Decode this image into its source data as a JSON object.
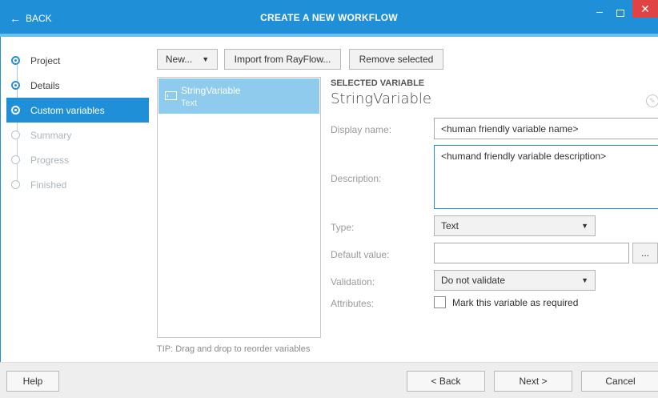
{
  "window": {
    "back_label": "BACK",
    "title": "CREATE A NEW WORKFLOW",
    "minimize_glyph": "–",
    "close_glyph": "✕",
    "accent_color": "#1f90d7"
  },
  "sidebar": {
    "steps": [
      {
        "label": "Project",
        "state": "done"
      },
      {
        "label": "Details",
        "state": "done"
      },
      {
        "label": "Custom variables",
        "state": "active"
      },
      {
        "label": "Summary",
        "state": "pending"
      },
      {
        "label": "Progress",
        "state": "pending"
      },
      {
        "label": "Finished",
        "state": "pending"
      }
    ]
  },
  "toolbar": {
    "new_label": "New...",
    "import_label": "Import from RayFlow...",
    "remove_label": "Remove selected"
  },
  "variables": {
    "items": [
      {
        "name": "StringVariable",
        "type": "Text",
        "icon": "text-variable-icon"
      }
    ],
    "tip": "TIP: Drag and drop to reorder variables"
  },
  "details": {
    "heading": "SELECTED VARIABLE",
    "variable_name": "StringVariable",
    "display_name_label": "Display name:",
    "display_name_value": "<human friendly variable name>",
    "description_label": "Description:",
    "description_value": "<humand friendly variable description>",
    "type_label": "Type:",
    "type_value": "Text",
    "default_value_label": "Default value:",
    "default_value": "",
    "browse_label": "...",
    "validation_label": "Validation:",
    "validation_value": "Do not validate",
    "attributes_label": "Attributes:",
    "required_label": "Mark this variable as required",
    "required_checked": false
  },
  "footer": {
    "help_label": "Help",
    "back_label": "< Back",
    "next_label": "Next >",
    "cancel_label": "Cancel"
  }
}
